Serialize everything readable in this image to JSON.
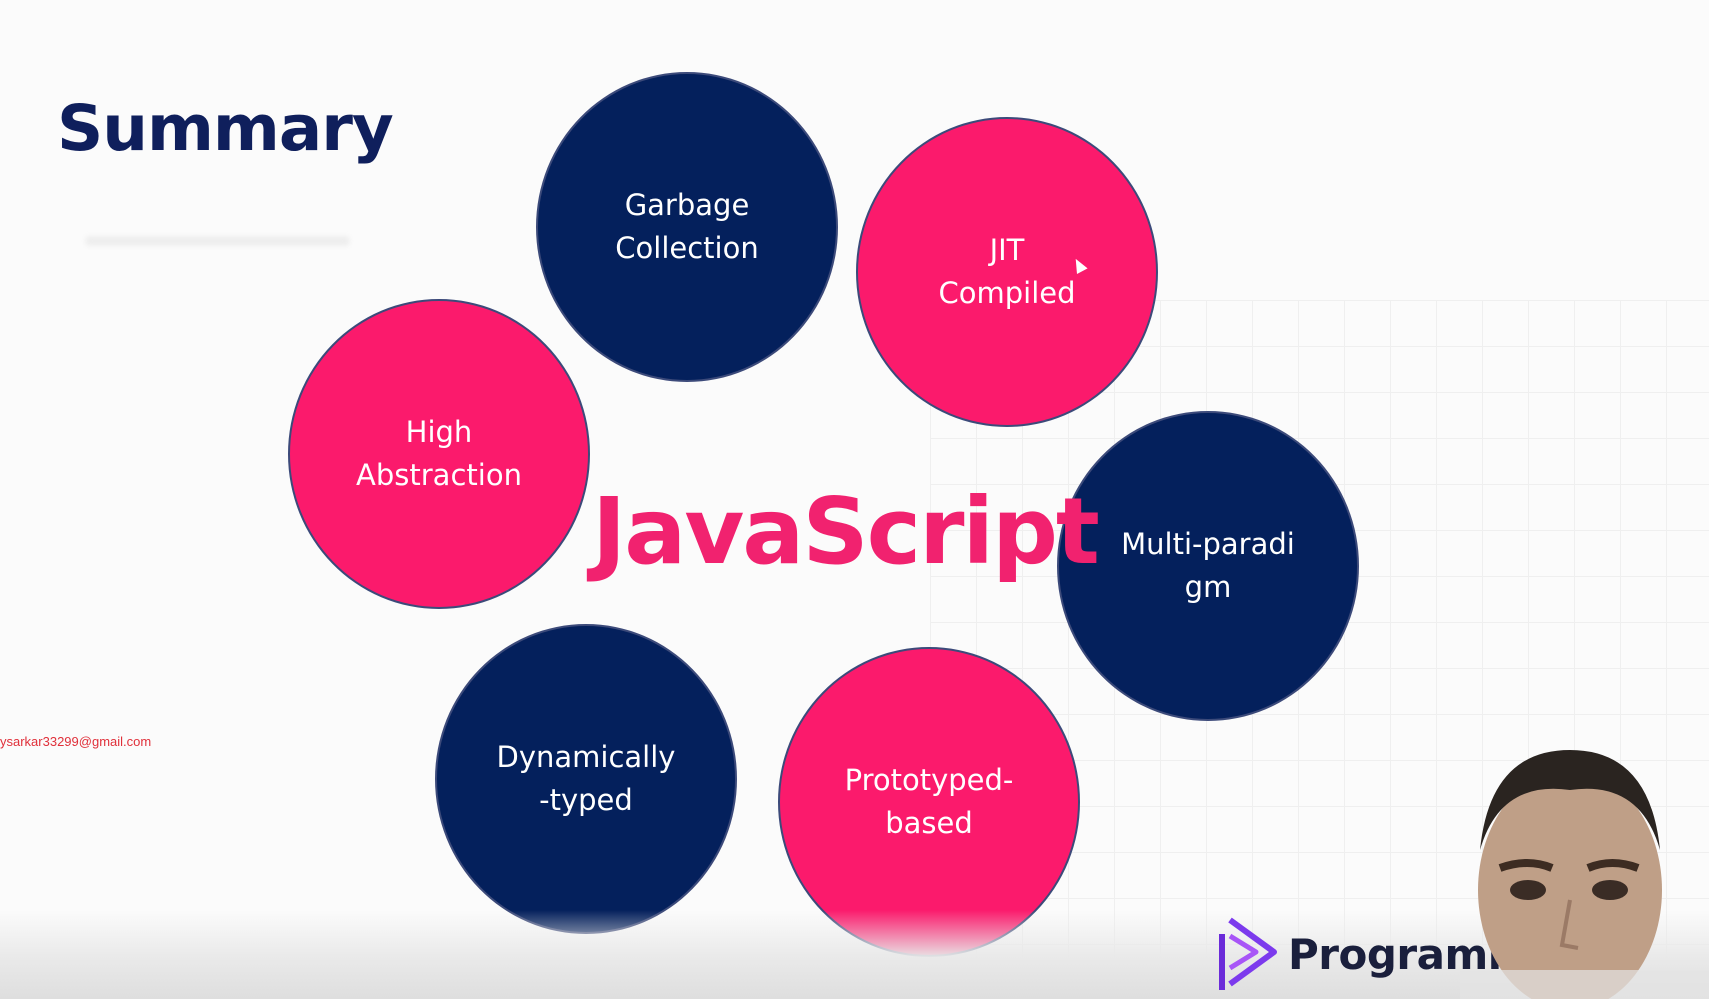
{
  "slide": {
    "title": "Summary",
    "center_word": "JavaScript",
    "circles": [
      {
        "label": "Garbage\nCollection",
        "color": "navy"
      },
      {
        "label": "JIT\nCompiled",
        "color": "pink"
      },
      {
        "label": "High\nAbstraction",
        "color": "pink"
      },
      {
        "label": "Multi-paradi\ngm",
        "color": "navy"
      },
      {
        "label": "Dynamically\n-typed",
        "color": "navy"
      },
      {
        "label": "Prototyped-\nbased",
        "color": "pink"
      }
    ]
  },
  "overlay": {
    "email": "ysarkar33299@gmail.com",
    "brand": "Programm    ero"
  },
  "colors": {
    "navy": "#04205c",
    "pink": "#fb1a6c",
    "title": "#0f1f5c",
    "accent_text": "#f1226f",
    "email_red": "#e0303a"
  },
  "icons": [
    "cursor-icon",
    "brand-logo-icon"
  ]
}
